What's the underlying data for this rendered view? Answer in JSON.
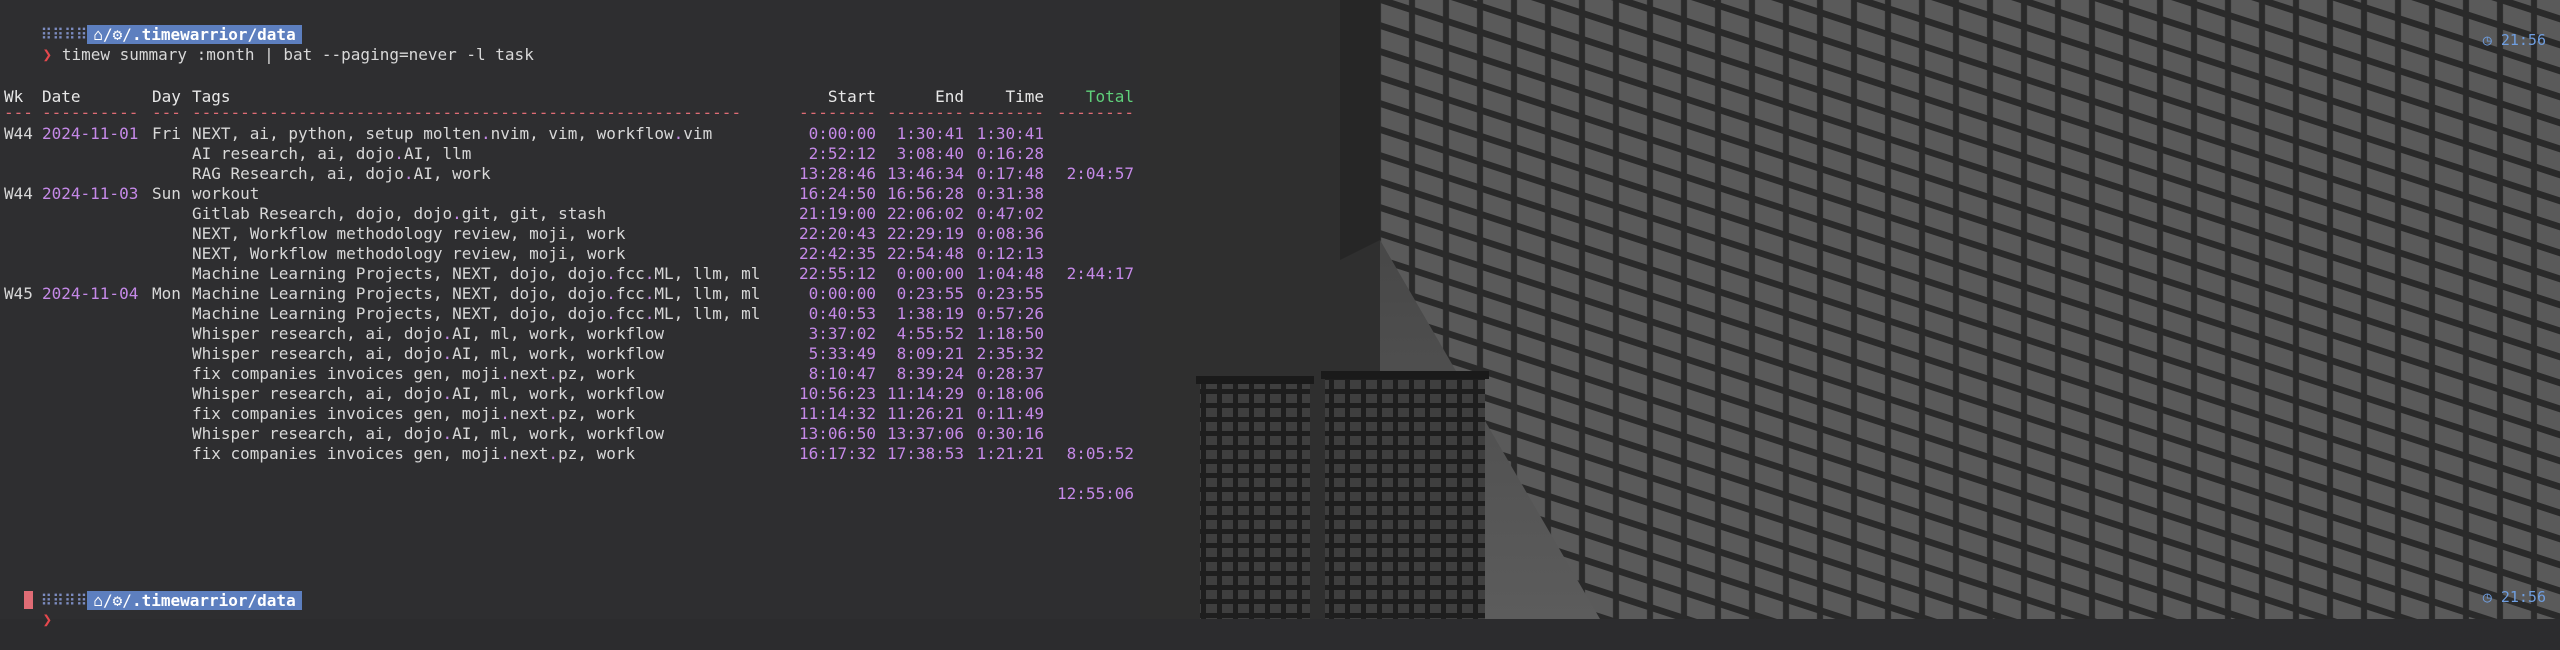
{
  "prompt": {
    "dots": "⠿⠿⠿⠿",
    "path_prefix": "⌂/⚙/",
    "path_main": ".timewarrior/data",
    "arrow": "❯",
    "command": "timew summary :month | bat --paging=never -l task",
    "time": "21:56",
    "time_icon": "clock-icon"
  },
  "table": {
    "headers": {
      "wk": "Wk",
      "date": "Date",
      "day": "Day",
      "tags": "Tags",
      "start": "Start",
      "end": "End",
      "time": "Time",
      "total": "Total"
    },
    "separators": {
      "wk": "---",
      "date": "----------",
      "day": "---",
      "tags": "---------------------------------------------------------",
      "start": "--------",
      "end": "--------",
      "time": "--------",
      "total": "--------"
    },
    "rows": [
      {
        "wk": "W44",
        "date": "2024-11-01",
        "day": "Fri",
        "tags": "NEXT, ai, python, setup molten.nvim, vim, workflow.vim",
        "start": "0:00:00",
        "end": "1:30:41",
        "time": "1:30:41",
        "total": ""
      },
      {
        "wk": "",
        "date": "",
        "day": "",
        "tags": "AI research, ai, dojo.AI, llm",
        "start": "2:52:12",
        "end": "3:08:40",
        "time": "0:16:28",
        "total": ""
      },
      {
        "wk": "",
        "date": "",
        "day": "",
        "tags": "RAG Research, ai, dojo.AI, work",
        "start": "13:28:46",
        "end": "13:46:34",
        "time": "0:17:48",
        "total": "2:04:57"
      },
      {
        "wk": "W44",
        "date": "2024-11-03",
        "day": "Sun",
        "tags": "workout",
        "start": "16:24:50",
        "end": "16:56:28",
        "time": "0:31:38",
        "total": ""
      },
      {
        "wk": "",
        "date": "",
        "day": "",
        "tags": "Gitlab Research, dojo, dojo.git, git, stash",
        "start": "21:19:00",
        "end": "22:06:02",
        "time": "0:47:02",
        "total": ""
      },
      {
        "wk": "",
        "date": "",
        "day": "",
        "tags": "NEXT, Workflow methodology review, moji, work",
        "start": "22:20:43",
        "end": "22:29:19",
        "time": "0:08:36",
        "total": ""
      },
      {
        "wk": "",
        "date": "",
        "day": "",
        "tags": "NEXT, Workflow methodology review, moji, work",
        "start": "22:42:35",
        "end": "22:54:48",
        "time": "0:12:13",
        "total": ""
      },
      {
        "wk": "",
        "date": "",
        "day": "",
        "tags": "Machine Learning Projects, NEXT, dojo, dojo.fcc.ML, llm, ml",
        "start": "22:55:12",
        "end": "0:00:00",
        "time": "1:04:48",
        "total": "2:44:17"
      },
      {
        "wk": "W45",
        "date": "2024-11-04",
        "day": "Mon",
        "tags": "Machine Learning Projects, NEXT, dojo, dojo.fcc.ML, llm, ml",
        "start": "0:00:00",
        "end": "0:23:55",
        "time": "0:23:55",
        "total": ""
      },
      {
        "wk": "",
        "date": "",
        "day": "",
        "tags": "Machine Learning Projects, NEXT, dojo, dojo.fcc.ML, llm, ml",
        "start": "0:40:53",
        "end": "1:38:19",
        "time": "0:57:26",
        "total": ""
      },
      {
        "wk": "",
        "date": "",
        "day": "",
        "tags": "Whisper research, ai, dojo.AI, ml, work, workflow",
        "start": "3:37:02",
        "end": "4:55:52",
        "time": "1:18:50",
        "total": ""
      },
      {
        "wk": "",
        "date": "",
        "day": "",
        "tags": "Whisper research, ai, dojo.AI, ml, work, workflow",
        "start": "5:33:49",
        "end": "8:09:21",
        "time": "2:35:32",
        "total": ""
      },
      {
        "wk": "",
        "date": "",
        "day": "",
        "tags": "fix companies invoices gen, moji.next.pz, work",
        "start": "8:10:47",
        "end": "8:39:24",
        "time": "0:28:37",
        "total": ""
      },
      {
        "wk": "",
        "date": "",
        "day": "",
        "tags": "Whisper research, ai, dojo.AI, ml, work, workflow",
        "start": "10:56:23",
        "end": "11:14:29",
        "time": "0:18:06",
        "total": ""
      },
      {
        "wk": "",
        "date": "",
        "day": "",
        "tags": "fix companies invoices gen, moji.next.pz, work",
        "start": "11:14:32",
        "end": "11:26:21",
        "time": "0:11:49",
        "total": ""
      },
      {
        "wk": "",
        "date": "",
        "day": "",
        "tags": "Whisper research, ai, dojo.AI, ml, work, workflow",
        "start": "13:06:50",
        "end": "13:37:06",
        "time": "0:30:16",
        "total": ""
      },
      {
        "wk": "",
        "date": "",
        "day": "",
        "tags": "fix companies invoices gen, moji.next.pz, work",
        "start": "16:17:32",
        "end": "17:38:53",
        "time": "1:21:21",
        "total": "8:05:52"
      }
    ],
    "grand_total": "12:55:06"
  },
  "colors": {
    "terminal_bg": "#2e2e30",
    "path_bg": "#5d7fbf",
    "arrow": "#e5484d",
    "date": "#c589e8",
    "total_header": "#5fd07a",
    "clock": "#6f9ee0"
  }
}
